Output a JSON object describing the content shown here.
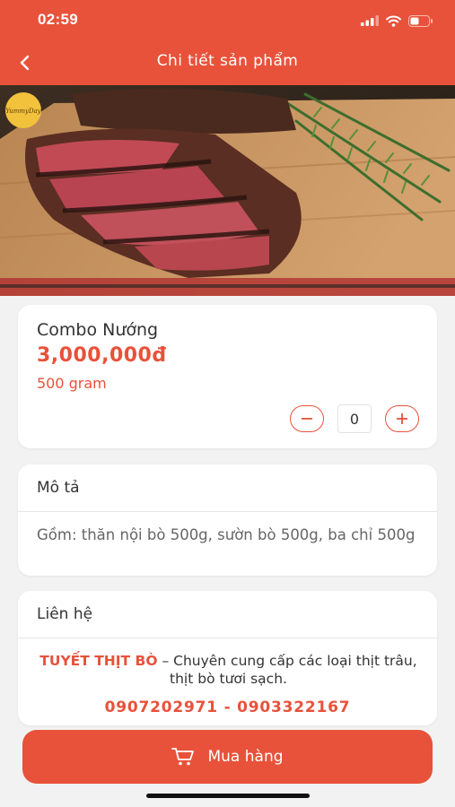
{
  "status_bar": {
    "time": "02:59"
  },
  "nav": {
    "title": "Chi tiết sản phẩm"
  },
  "product": {
    "name": "Combo Nướng",
    "price": "3,000,000đ",
    "unit": "500 gram",
    "quantity": "0",
    "logo_text": "YummyDay"
  },
  "description": {
    "title": "Mô tả",
    "text": "Gồm: thăn nội bò 500g, sườn bò 500g, ba chỉ 500g"
  },
  "contact": {
    "title": "Liên hệ",
    "brand": "TUYẾT THỊT BÒ",
    "tagline": " – Chuyên cung cấp các loại thịt trâu, thịt bò tươi sạch.",
    "phones": "0907202971 - 0903322167"
  },
  "buy_button": {
    "label": "Mua hàng"
  },
  "colors": {
    "accent": "#e8523a",
    "background": "#f2f2f2"
  },
  "icons": [
    "back-chevron-icon",
    "signal-icon",
    "wifi-icon",
    "battery-icon",
    "minus-icon",
    "plus-icon",
    "cart-icon"
  ]
}
